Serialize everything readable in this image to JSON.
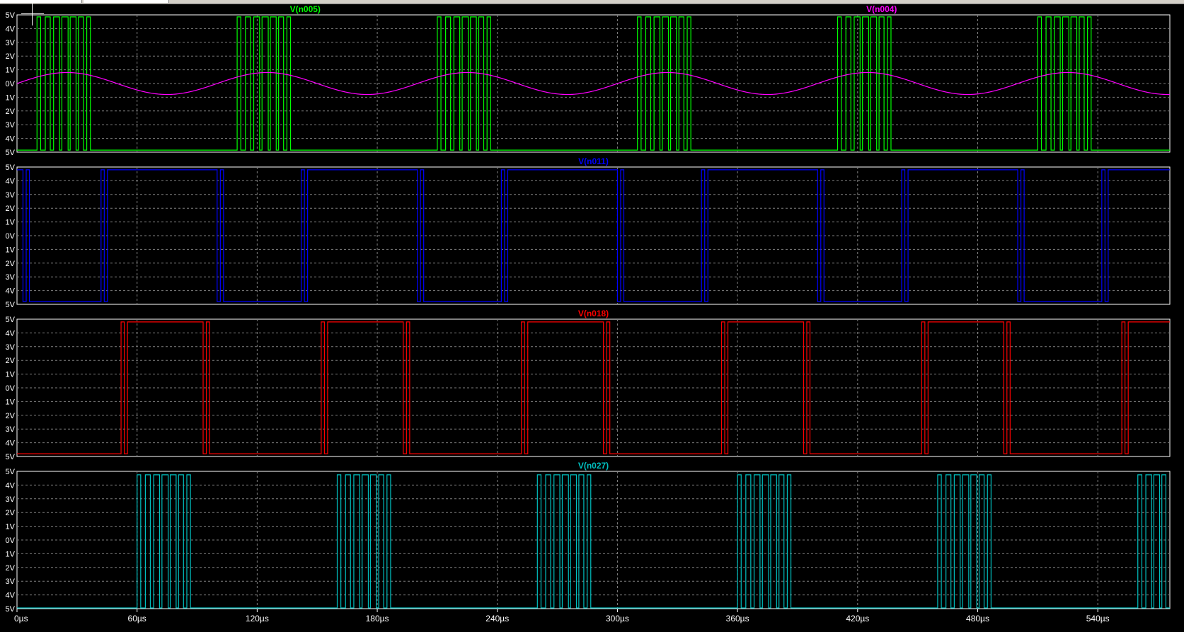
{
  "chart_data": {
    "type": "line",
    "x_unit": "µs",
    "x_range": [
      0,
      576
    ],
    "x_ticks": [
      "0µs",
      "60µs",
      "120µs",
      "180µs",
      "240µs",
      "300µs",
      "360µs",
      "420µs",
      "480µs",
      "540µs"
    ],
    "y_tick_labels": [
      "5V",
      "4V",
      "3V",
      "2V",
      "1V",
      "0V",
      "1V",
      "2V",
      "3V",
      "4V",
      "5V"
    ],
    "grid": true,
    "panes": [
      {
        "ylim": [
          -5,
          5
        ],
        "series": [
          {
            "name": "V(n005)",
            "color": "#00ff00",
            "kind": "pwm",
            "amplitude": 4.85,
            "baseline": -4.85,
            "bursts": [
              {
                "start": 10,
                "end": 39,
                "count": 7
              },
              {
                "start": 110,
                "end": 139,
                "count": 7
              },
              {
                "start": 210,
                "end": 239,
                "count": 7
              },
              {
                "start": 310,
                "end": 339,
                "count": 7
              },
              {
                "start": 410,
                "end": 439,
                "count": 7
              },
              {
                "start": 510,
                "end": 539,
                "count": 7
              }
            ]
          },
          {
            "name": "V(n004)",
            "color": "#ff00ff",
            "kind": "sine",
            "amplitude": 0.8,
            "period": 100,
            "phase_deg": 0
          }
        ]
      },
      {
        "ylim": [
          -5,
          5
        ],
        "series": [
          {
            "name": "V(n011)",
            "color": "#0000ff",
            "kind": "square",
            "high": 4.8,
            "low": -4.8,
            "starts_high": true,
            "transitions": [
              {
                "t": 3,
                "count": 3
              },
              {
                "t": 42,
                "count": 3
              },
              {
                "t": 100,
                "count": 3
              },
              {
                "t": 142,
                "count": 3
              },
              {
                "t": 200,
                "count": 3
              },
              {
                "t": 242,
                "count": 3
              },
              {
                "t": 300,
                "count": 3
              },
              {
                "t": 342,
                "count": 3
              },
              {
                "t": 400,
                "count": 3
              },
              {
                "t": 442,
                "count": 3
              },
              {
                "t": 500,
                "count": 3
              },
              {
                "t": 542,
                "count": 3
              }
            ]
          }
        ]
      },
      {
        "ylim": [
          -5,
          5
        ],
        "series": [
          {
            "name": "V(n018)",
            "color": "#ff0000",
            "kind": "square",
            "high": 4.8,
            "low": -4.8,
            "starts_high": false,
            "transitions": [
              {
                "t": 52,
                "count": 3
              },
              {
                "t": 93,
                "count": 3
              },
              {
                "t": 152,
                "count": 3
              },
              {
                "t": 193,
                "count": 3
              },
              {
                "t": 252,
                "count": 3
              },
              {
                "t": 293,
                "count": 3
              },
              {
                "t": 352,
                "count": 3
              },
              {
                "t": 393,
                "count": 3
              },
              {
                "t": 452,
                "count": 3
              },
              {
                "t": 493,
                "count": 3
              },
              {
                "t": 552,
                "count": 3
              }
            ]
          }
        ]
      },
      {
        "ylim": [
          -5,
          5
        ],
        "series": [
          {
            "name": "V(n027)",
            "color": "#00c0c0",
            "kind": "pwm",
            "amplitude": 4.75,
            "baseline": -4.95,
            "bursts": [
              {
                "start": 60,
                "end": 89,
                "count": 7
              },
              {
                "start": 160,
                "end": 189,
                "count": 7
              },
              {
                "start": 260,
                "end": 289,
                "count": 7
              },
              {
                "start": 360,
                "end": 389,
                "count": 7
              },
              {
                "start": 460,
                "end": 489,
                "count": 7
              },
              {
                "start": 560,
                "end": 576,
                "count": 4
              }
            ]
          }
        ]
      }
    ]
  },
  "colors": {
    "background": "#000000",
    "frame": "#ffffff",
    "grid": "#808080",
    "tick_text": "#ffffff"
  }
}
